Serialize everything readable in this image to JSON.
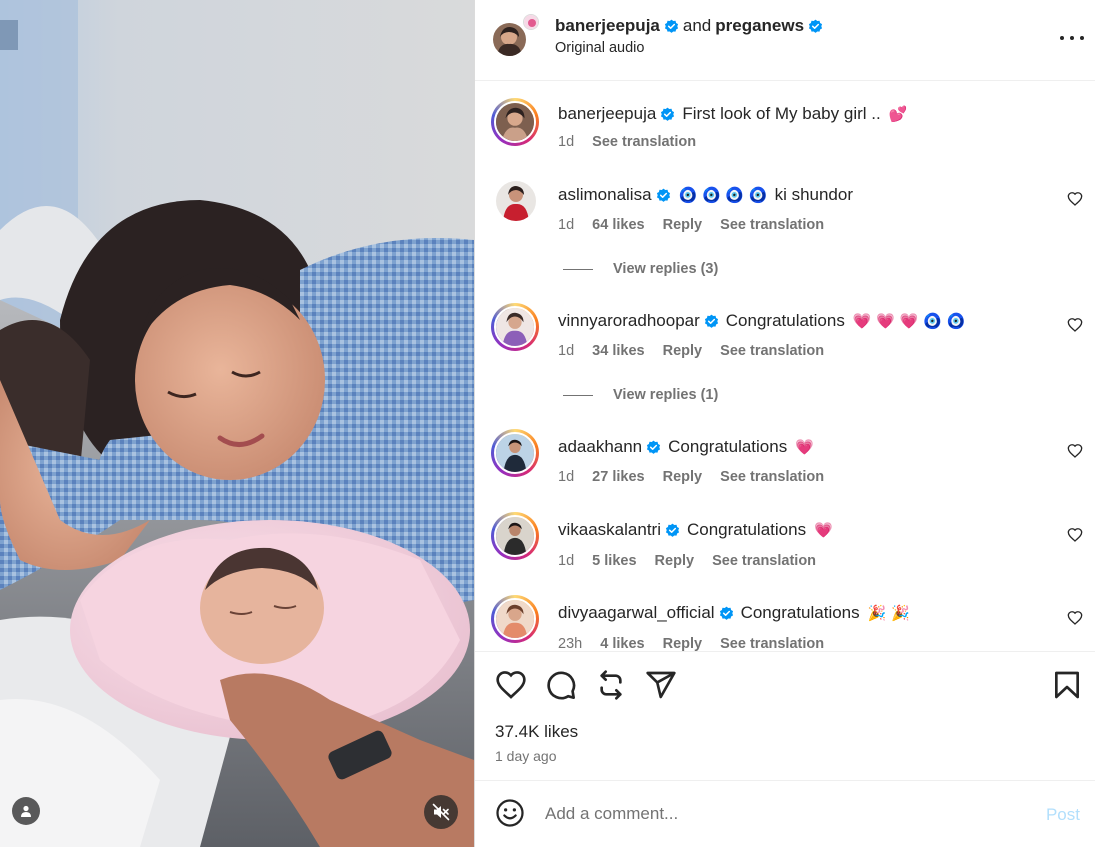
{
  "post": {
    "authors": [
      "banerjeepuja",
      "preganews"
    ],
    "and_text": "and",
    "audio": "Original audio",
    "caption_user": "banerjeepuja",
    "caption_text": "First look of My baby girl ..",
    "caption_emoji": "💕",
    "caption_time": "1d",
    "see_translation": "See translation",
    "likes": "37.4K likes",
    "time_ago": "1 day ago"
  },
  "comments": [
    {
      "user": "aslimonalisa",
      "text": "ki shundor",
      "emoji": "🧿 🧿 🧿 🧿",
      "time": "1d",
      "likes": "64 likes",
      "reply": "Reply",
      "see_translation": "See translation",
      "view_replies": "View replies (3)"
    },
    {
      "user": "vinnyaroradhoopar",
      "text": "Congratulations",
      "emoji": "💗 💗 💗 🧿 🧿",
      "time": "1d",
      "likes": "34 likes",
      "reply": "Reply",
      "see_translation": "See translation",
      "view_replies": "View replies (1)"
    },
    {
      "user": "adaakhann",
      "text": "Congratulations",
      "emoji": "💗",
      "time": "1d",
      "likes": "27 likes",
      "reply": "Reply",
      "see_translation": "See translation"
    },
    {
      "user": "vikaaskalantri",
      "text": "Congratulations",
      "emoji": "💗",
      "time": "1d",
      "likes": "5 likes",
      "reply": "Reply",
      "see_translation": "See translation"
    },
    {
      "user": "divyaagarwal_official",
      "text": "Congratulations",
      "emoji": "🎉 🎉",
      "time": "23h",
      "likes": "4 likes",
      "reply": "Reply",
      "see_translation": "See translation"
    }
  ],
  "add_comment": {
    "placeholder": "Add a comment...",
    "post_label": "Post"
  },
  "icons": [
    "heart-icon",
    "comment-icon",
    "repost-icon",
    "share-icon",
    "bookmark-icon",
    "emoji-icon",
    "more-icon",
    "verified-icon",
    "mute-icon",
    "user-tag-icon"
  ],
  "colors": {
    "verified": "#0095f6",
    "post_disabled": "#b2dffc",
    "muted_text": "#737373",
    "heart_emoji": "#e8346b"
  }
}
